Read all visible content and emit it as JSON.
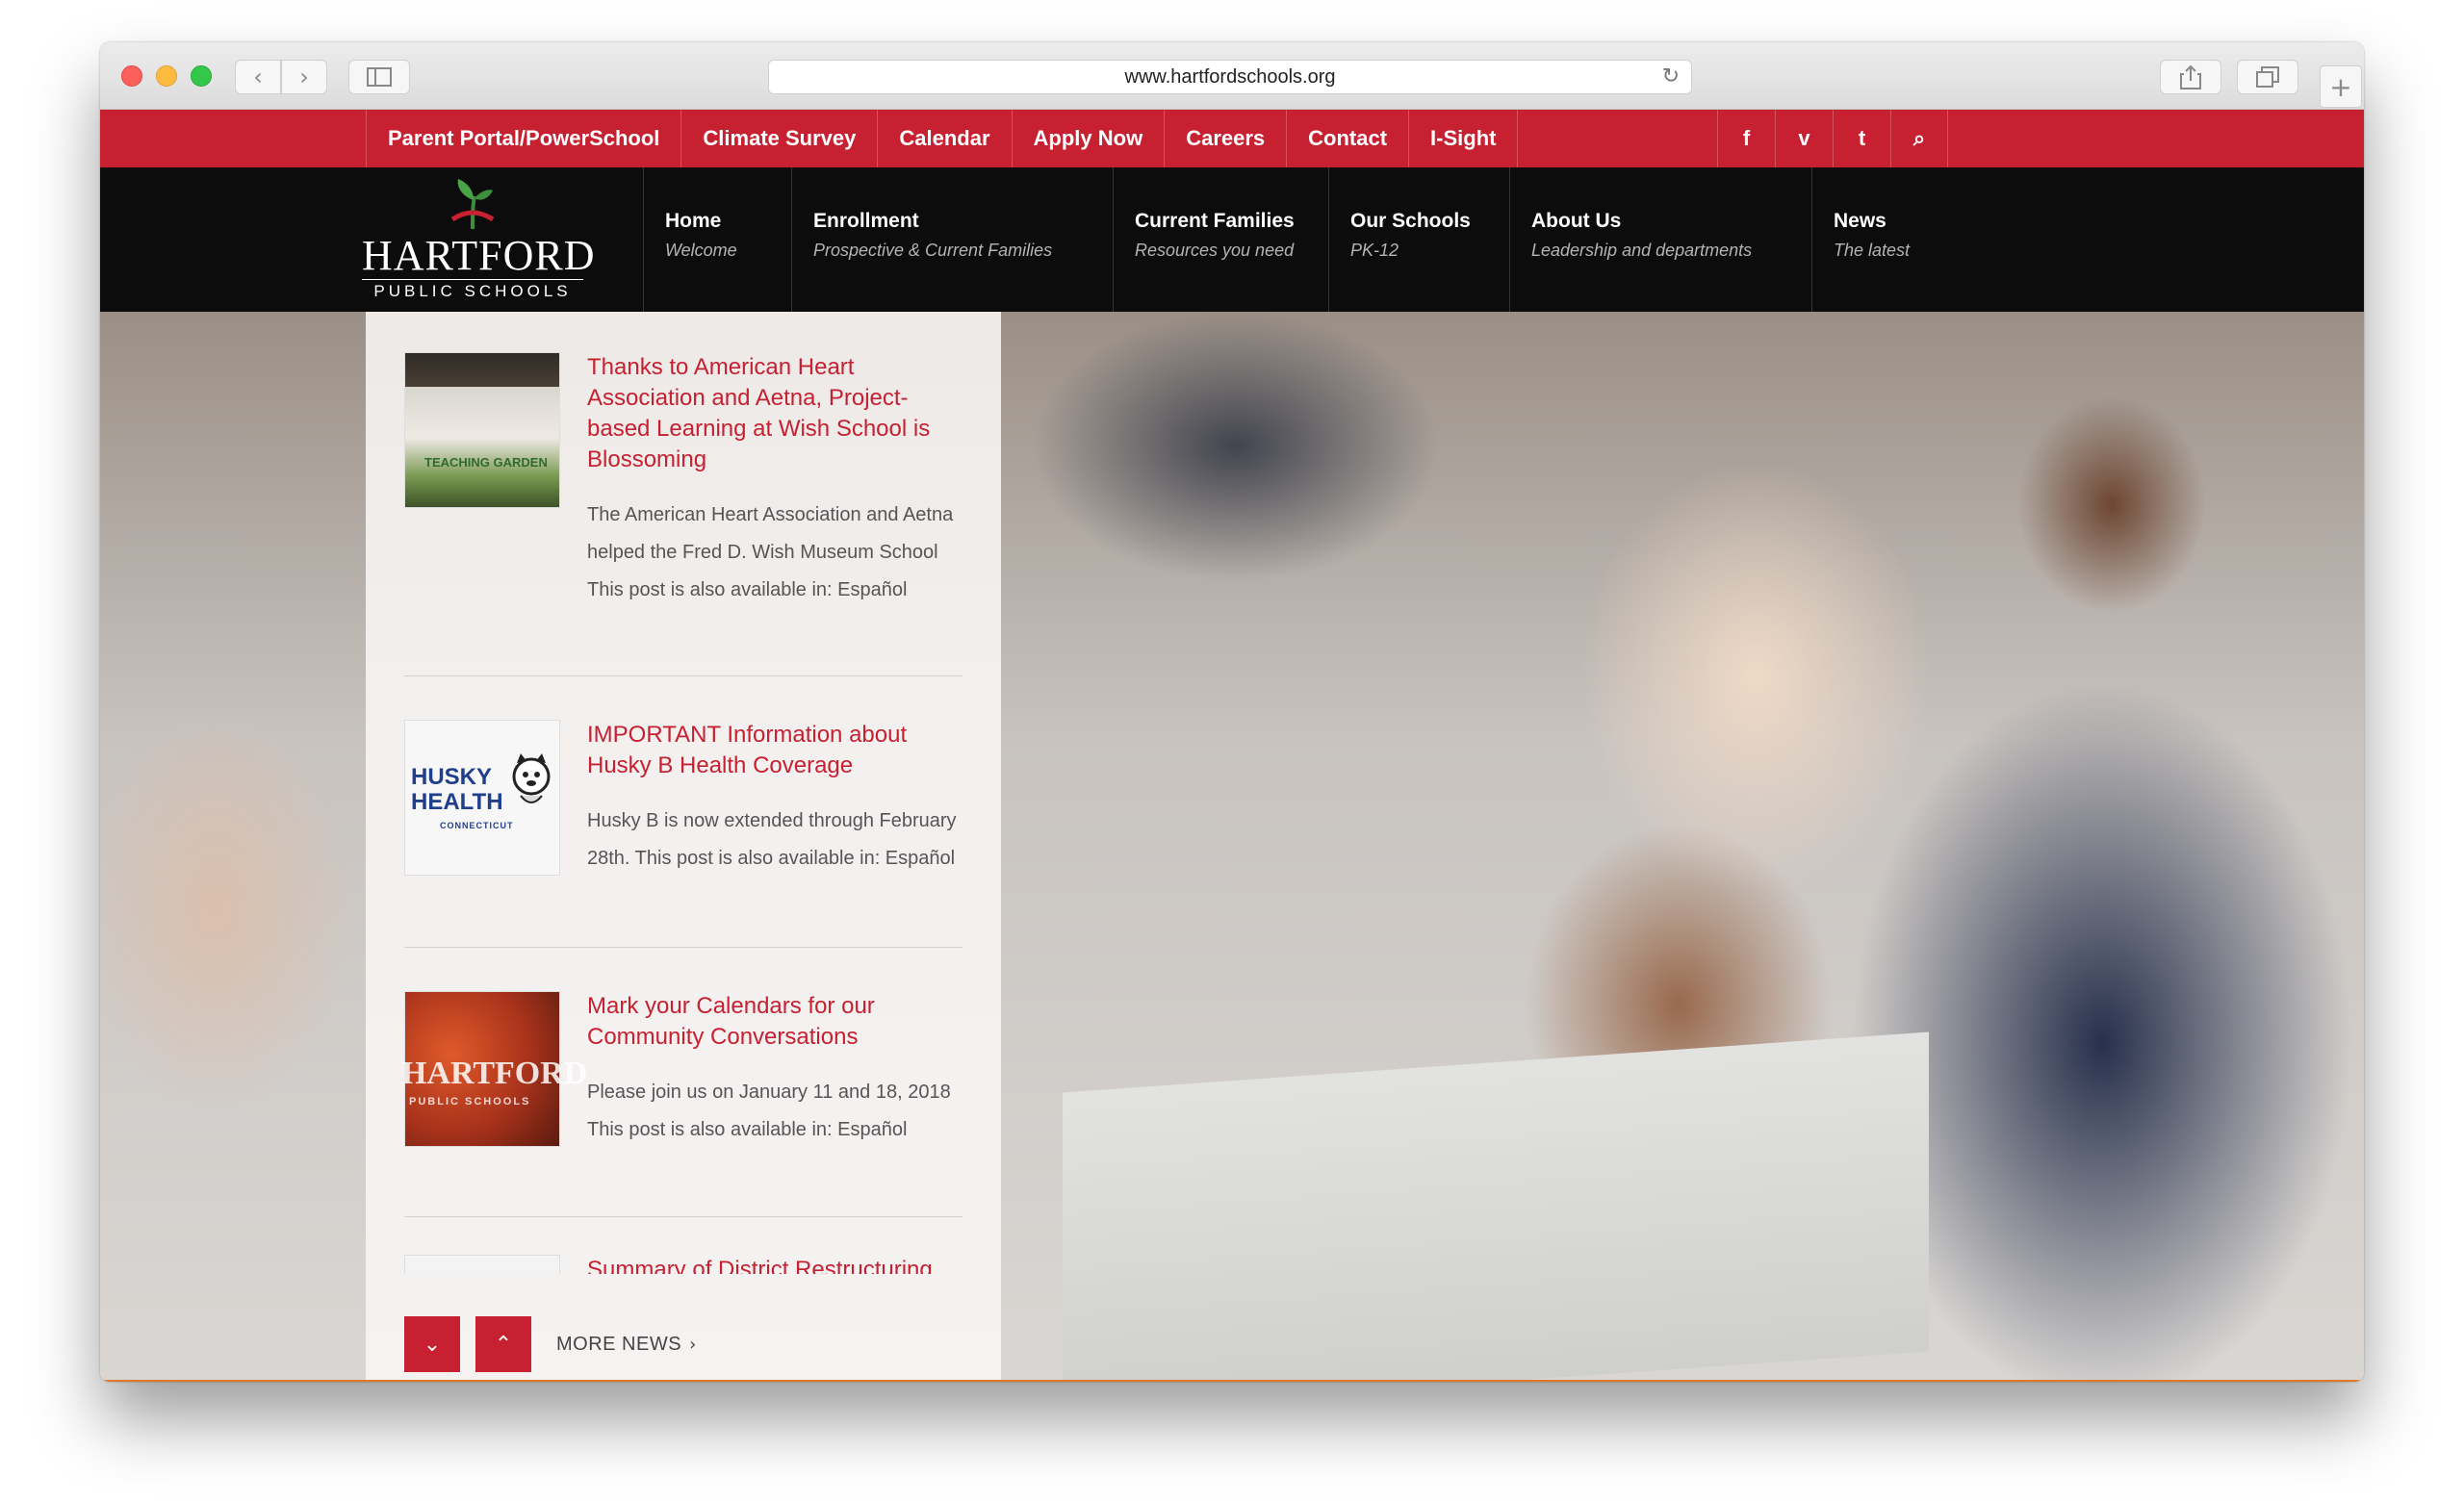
{
  "browser": {
    "url": "www.hartfordschools.org"
  },
  "topnav": {
    "items": [
      "Parent Portal/PowerSchool",
      "Climate Survey",
      "Calendar",
      "Apply Now",
      "Careers",
      "Contact",
      "I-Sight"
    ],
    "social": [
      "facebook-icon",
      "vimeo-icon",
      "twitter-icon",
      "search-icon"
    ],
    "social_glyphs": [
      "f",
      "v",
      "t",
      "⌕"
    ]
  },
  "logo": {
    "name": "HARTFORD",
    "subtitle": "PUBLIC SCHOOLS"
  },
  "mainnav": {
    "items": [
      {
        "title": "Home",
        "sub": "Welcome"
      },
      {
        "title": "Enrollment",
        "sub": "Prospective & Current Families"
      },
      {
        "title": "Current Families",
        "sub": "Resources you need"
      },
      {
        "title": "Our Schools",
        "sub": "PK-12"
      },
      {
        "title": "About Us",
        "sub": "Leadership and departments"
      },
      {
        "title": "News",
        "sub": "The latest"
      }
    ]
  },
  "news": {
    "items": [
      {
        "title": "Thanks to American Heart Association and Aetna, Project-based Learning at Wish School is Blossoming",
        "excerpt": "The American Heart Association and Aetna helped the Fred D. Wish Museum School This post is also available in: Español",
        "thumb_text": "TEACHING GARDEN"
      },
      {
        "title": "IMPORTANT Information about Husky B Health Coverage",
        "excerpt": "Husky B is now extended through February 28th.  This post is also available in: Español",
        "thumb_text": "HUSKY HEALTH",
        "thumb_sub": "CONNECTICUT"
      },
      {
        "title": "Mark your Calendars for our Community Conversations",
        "excerpt": "Please join us on January 11 and 18, 2018  This post is also available in: Español",
        "thumb_text": "HARTFORD",
        "thumb_sub": "PUBLIC SCHOOLS"
      },
      {
        "title": "Summary of District Restructuring"
      }
    ],
    "down_label": "⌄",
    "up_label": "⌃",
    "more_label": "MORE NEWS",
    "more_chevron": "›"
  },
  "colors": {
    "brand_red": "#c62031",
    "header_black": "#0c0c0c",
    "accent_orange": "#e0772b"
  }
}
